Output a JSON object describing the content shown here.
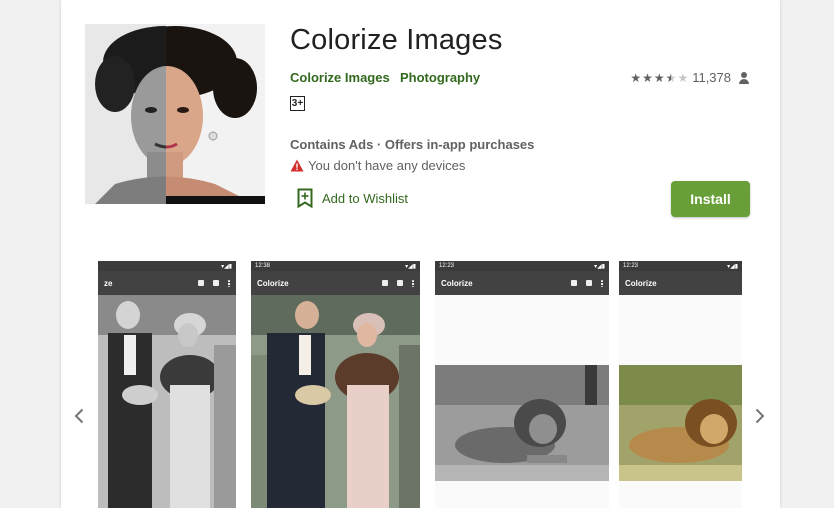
{
  "app": {
    "title": "Colorize Images",
    "developer": "Colorize Images",
    "category": "Photography",
    "age_rating": "3+",
    "rating_count": "11,378",
    "rating_value": 3.5,
    "ads_info": "Contains Ads · Offers in-app purchases",
    "device_warning": "You don't have any devices",
    "wishlist_label": "Add to Wishlist",
    "install_label": "Install"
  },
  "colors": {
    "accent_green": "#689f38",
    "link_green": "#33691e",
    "warning_red": "#d32f2f"
  },
  "icons": {
    "warning": "warning-triangle-icon",
    "wishlist": "bookmark-add-icon",
    "reviewer": "person-icon",
    "prev": "chevron-left-icon",
    "next": "chevron-right-icon"
  },
  "screenshots": [
    {
      "status_time": "",
      "toolbar_title": "ze",
      "variant": "couple-bw"
    },
    {
      "status_time": "12:38",
      "toolbar_title": "Colorize",
      "variant": "couple-color"
    },
    {
      "status_time": "12:23",
      "toolbar_title": "Colorize",
      "variant": "lion-bw"
    },
    {
      "status_time": "12:23",
      "toolbar_title": "Colorize",
      "variant": "lion-color"
    }
  ]
}
